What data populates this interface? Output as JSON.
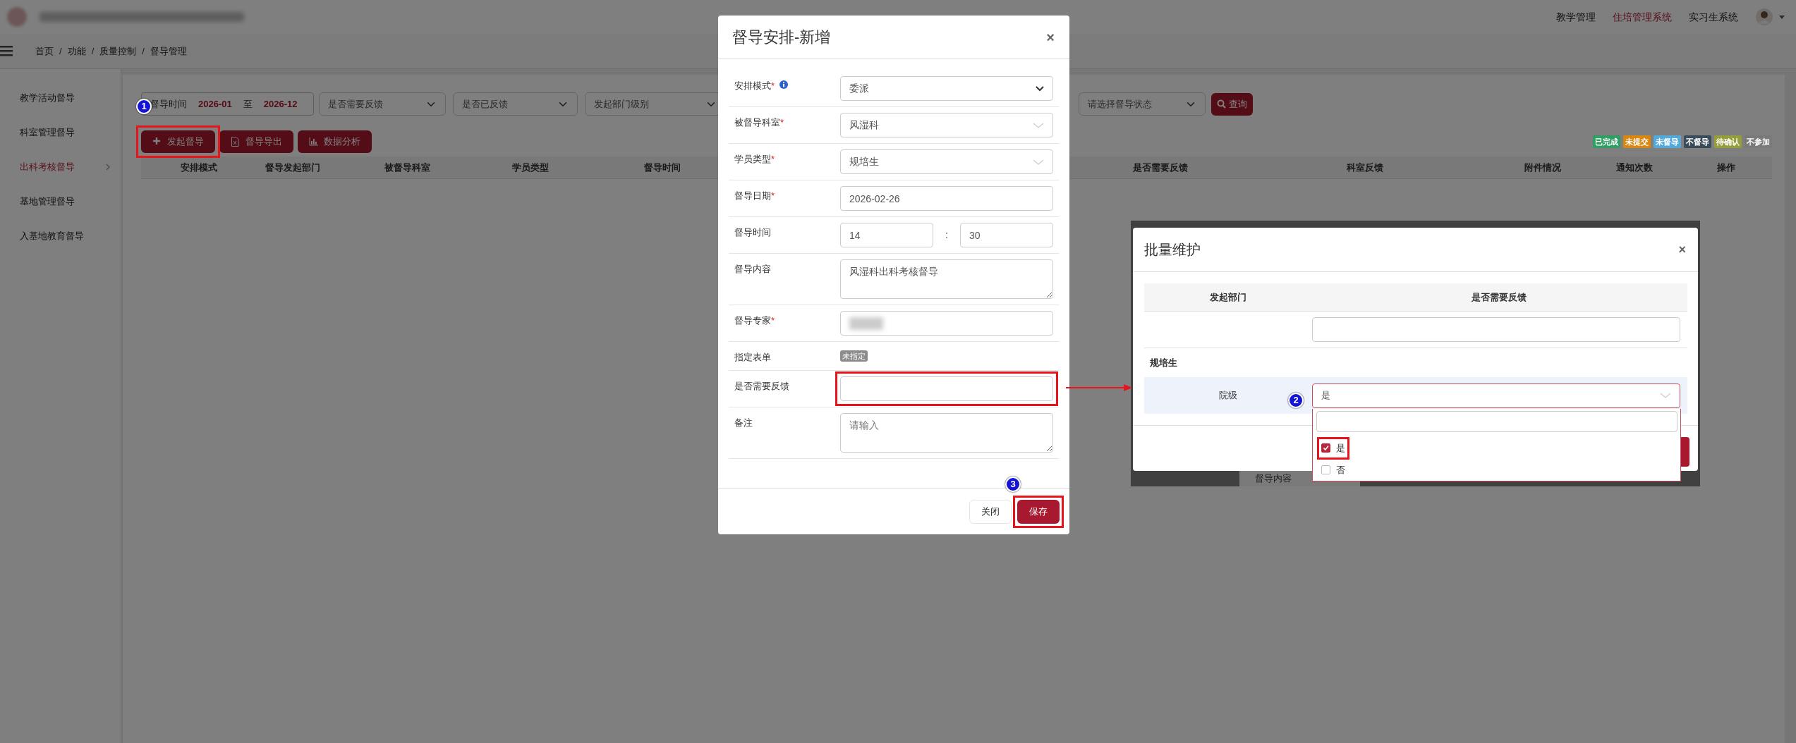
{
  "header": {
    "nav": [
      {
        "label": "教学管理",
        "selected": false
      },
      {
        "label": "住培管理系统",
        "selected": true
      },
      {
        "label": "实习生系统",
        "selected": false
      }
    ]
  },
  "breadcrumb": [
    "首页",
    "功能",
    "质量控制",
    "督导管理"
  ],
  "breadcrumb_separator": "/",
  "sidebar": {
    "items": [
      {
        "label": "教学活动督导",
        "selected": false
      },
      {
        "label": "科室管理督导",
        "selected": false
      },
      {
        "label": "出科考核督导",
        "selected": true
      },
      {
        "label": "基地管理督导",
        "selected": false
      },
      {
        "label": "入基地教育督导",
        "selected": false
      }
    ]
  },
  "filters": {
    "date_range": {
      "label": "督导时间",
      "start": "2026-01",
      "separator": "至",
      "end": "2026-12"
    },
    "selects": [
      "是否需要反馈",
      "是否已反馈",
      "发起部门级别"
    ],
    "status_select": "请选择督导状态",
    "query_button": "查询"
  },
  "toolbar": [
    {
      "label": "发起督导",
      "kind": "plus",
      "annotated": true
    },
    {
      "label": "督导导出",
      "kind": "file",
      "annotated": false
    },
    {
      "label": "数据分析",
      "kind": "chart",
      "annotated": false
    }
  ],
  "legend": [
    {
      "label": "已完成",
      "color": "#2e9e63"
    },
    {
      "label": "未提交",
      "color": "#d9870f"
    },
    {
      "label": "未督导",
      "color": "#55a9d9"
    },
    {
      "label": "不督导",
      "color": "#3a4c59"
    },
    {
      "label": "待确认",
      "color": "#969e3c"
    },
    {
      "label": "不参加",
      "color": "#7a7a7a"
    }
  ],
  "table": {
    "columns": [
      "安排模式",
      "督导发起部门",
      "被督导科室",
      "学员类型",
      "督导时间",
      "是否需要反馈",
      "科室反馈",
      "附件情况",
      "通知次数",
      "操作"
    ]
  },
  "modal": {
    "title": "督导安排-新增",
    "close": "×",
    "fields": [
      {
        "label": "安排模式",
        "required_mark": "*",
        "info": true,
        "kind": "select",
        "value": "委派",
        "annotated": false
      },
      {
        "label": "被督导科室",
        "required_mark": "*",
        "info": false,
        "kind": "select2",
        "value": "风湿科",
        "annotated": false
      },
      {
        "label": "学员类型",
        "required_mark": "*",
        "info": false,
        "kind": "select2",
        "value": "规培生",
        "annotated": false
      },
      {
        "label": "督导日期",
        "required_mark": "*",
        "info": false,
        "kind": "input",
        "value": "2026-02-26",
        "annotated": false
      },
      {
        "label": "督导时间",
        "info": false,
        "kind": "time",
        "hour": "14",
        "separator": ":",
        "minute": "30",
        "annotated": false
      },
      {
        "label": "督导内容",
        "info": false,
        "kind": "textarea",
        "value": "风湿科出科考核督导",
        "annotated": false
      },
      {
        "label": "督导专家",
        "required_mark": "*",
        "info": false,
        "kind": "redacted",
        "annotated": false
      },
      {
        "label": "指定表单",
        "info": false,
        "kind": "badge",
        "value": "未指定",
        "annotated": false
      },
      {
        "label": "是否需要反馈",
        "info": false,
        "kind": "input",
        "annotated": true
      },
      {
        "label": "备注",
        "info": false,
        "kind": "textarea",
        "placeholder": "请输入",
        "annotated": false
      }
    ],
    "buttons": [
      {
        "label": "关闭",
        "kind": "secondary",
        "annotated": false
      },
      {
        "label": "保存",
        "kind": "primary",
        "annotated": true
      }
    ]
  },
  "batch_modal": {
    "title": "批量维护",
    "close": "×",
    "columns": [
      "发起部门",
      "是否需要反馈"
    ],
    "group": "规培生",
    "row": {
      "department": "院级",
      "value": "是"
    },
    "options": [
      {
        "label": "是",
        "checked": true,
        "annotated": true
      },
      {
        "label": "否",
        "checked": false,
        "annotated": false
      }
    ],
    "behind_label": "督导内容"
  },
  "annotations": [
    {
      "number": "1"
    },
    {
      "number": "2"
    },
    {
      "number": "3"
    }
  ]
}
